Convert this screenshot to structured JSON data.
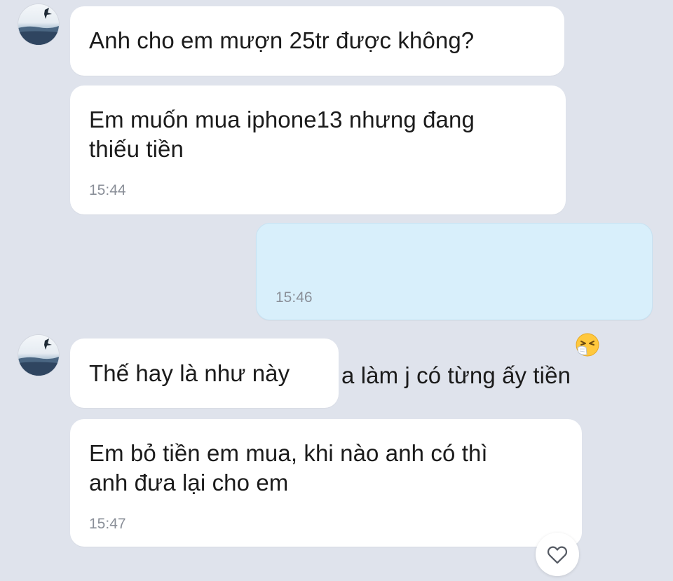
{
  "conversation": {
    "messages": [
      {
        "sender": "contact",
        "text": "Anh cho em mượn 25tr được không?"
      },
      {
        "sender": "contact",
        "text": "Em muốn mua iphone13 nhưng đang\nthiếu tiền",
        "time": "15:44"
      },
      {
        "sender": "me",
        "text": "giờ a làm j có từng ấy tiền",
        "emoji": "sneezing-face-emoji",
        "time": "15:46"
      },
      {
        "sender": "contact",
        "text": "Thế hay là như này"
      },
      {
        "sender": "contact",
        "text": "Em bỏ tiền em mua, khi nào anh có thì\nanh đưa lại cho em",
        "time": "15:47"
      }
    ]
  },
  "colors": {
    "background": "#dfe3ec",
    "received_bubble": "#ffffff",
    "sent_bubble": "#d8effb",
    "timestamp": "#8a8f98"
  },
  "icons": {
    "avatar": "contact-avatar",
    "emoji": "sneezing-face-emoji",
    "reaction": "heart-icon"
  }
}
